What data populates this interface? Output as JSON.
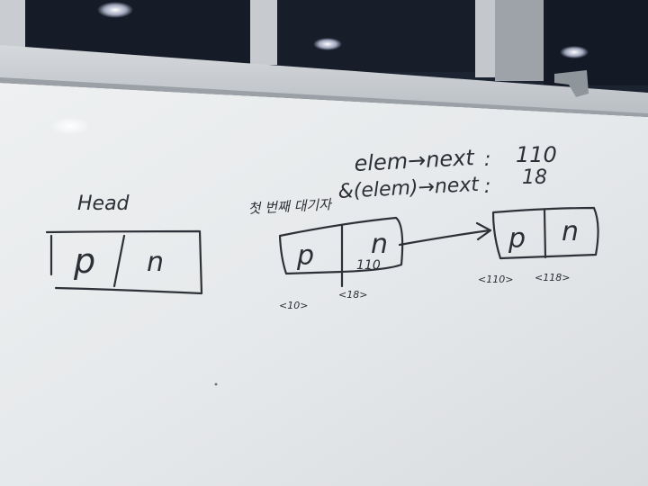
{
  "board": {
    "head_label": "Head",
    "head_node": {
      "p": "p",
      "n": "n"
    },
    "first_node": {
      "caption": "첫 번째 대기자",
      "p": "p",
      "n": "n",
      "n_value": "110",
      "addr_p": "<10>",
      "addr_n": "<18>"
    },
    "second_node": {
      "p": "p",
      "n": "n",
      "addr_p": "<110>",
      "addr_n": "<118>"
    },
    "equations": [
      {
        "lhs": "elem→next",
        "sep": ":",
        "rhs": "110"
      },
      {
        "lhs": "&(elem)→next",
        "sep": ":",
        "rhs": "18"
      }
    ]
  },
  "colors": {
    "marker": "#2f3138",
    "whiteboard": "#e9ecee",
    "wall": "#1b2230"
  }
}
